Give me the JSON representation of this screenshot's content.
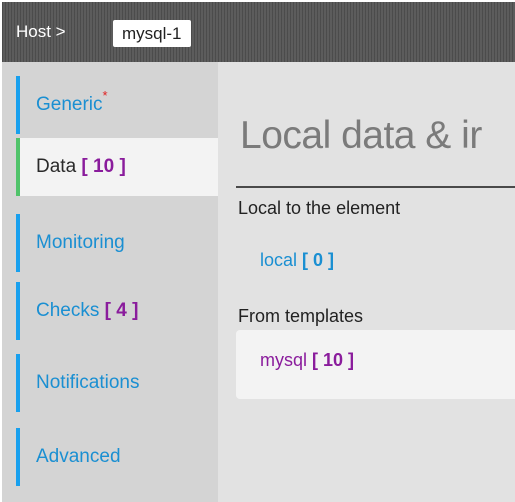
{
  "header": {
    "label": "Host >",
    "host_name": "mysql-1"
  },
  "sidebar": {
    "items": [
      {
        "label": "Generic",
        "count": "",
        "required_mark": "*",
        "state": "inactive"
      },
      {
        "label": "Data",
        "count": "[ 10 ]",
        "required_mark": "",
        "state": "active"
      },
      {
        "label": "Monitoring",
        "count": "",
        "required_mark": "",
        "state": "inactive"
      },
      {
        "label": "Checks",
        "count": "[ 4 ]",
        "required_mark": "",
        "state": "inactive"
      },
      {
        "label": "Notifications",
        "count": "",
        "required_mark": "",
        "state": "inactive"
      },
      {
        "label": "Advanced",
        "count": "",
        "required_mark": "",
        "state": "inactive"
      }
    ]
  },
  "main": {
    "title": "Local data & ir",
    "local_section_label": "Local to the element",
    "local_link": {
      "label": "local",
      "count": "[ 0 ]"
    },
    "templates_section_label": "From templates",
    "template_link": {
      "label": "mysql",
      "count": "[ 10 ]"
    }
  },
  "colors": {
    "link_blue": "#1a8fd2",
    "count_purple": "#8a1c9c",
    "active_green": "#50c36a",
    "inactive_bar_blue": "#18a0ee"
  }
}
